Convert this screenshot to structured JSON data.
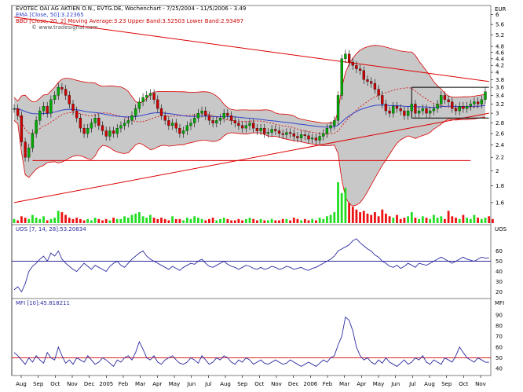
{
  "title": "EVOTEC OAI AG AKTIEN O.N., EVTG.DE, Wochenchart - 7/25/2004 - 11/5/2006 - 3.49",
  "watermark": "© www.tradesignal.com",
  "price_axis_label": "EUR",
  "indicators": {
    "ema": "EMA [Close, 50]:3.22365",
    "bbd": "BBD [Close, 20, 2] Moving Average:3.23 Upper Band:3.52503 Lower Band:2.93497",
    "uos": "UOS [7, 14, 28]:53.20834",
    "uos_axis_label": "UOS",
    "mfi": "MFI [10]:45.818211",
    "mfi_axis_label": "MFI"
  },
  "x_axis_labels": [
    "Aug",
    "Sep",
    "Oct",
    "Nov",
    "Dec",
    "2005",
    "Feb",
    "Mar",
    "Apr",
    "May",
    "Jun",
    "Jul",
    "Aug",
    "Sep",
    "Oct",
    "Nov",
    "Dec",
    "2006",
    "Feb",
    "Mar",
    "Apr",
    "May",
    "Jun",
    "Jul",
    "Aug",
    "Sep",
    "Oct",
    "Nov"
  ],
  "colors": {
    "candle_up": "#00aa00",
    "candle_down": "#cc0000",
    "ema_line": "#3344cc",
    "band_fill": "#c8c8c8",
    "trend_line": "#dd0000",
    "volume_up": "#22dd22",
    "volume_down": "#ee1111",
    "oscillator_line": "#2a2aa0"
  },
  "chart_data": [
    {
      "type": "candlestick",
      "title": "EVOTEC OAI AG AKTIEN O.N., EVTG.DE, Wochenchart - 7/25/2004 - 11/5/2006 - 3.49",
      "ylabel": "EUR",
      "y_scale": "log",
      "ylim": [
        1.4,
        6.4
      ],
      "y_ticks": [
        1.6,
        1.8,
        2,
        2.2,
        2.4,
        2.6,
        2.8,
        3,
        3.2,
        3.4,
        3.6,
        3.8,
        4,
        4.2,
        4.4,
        4.6,
        4.8,
        5.2,
        5.6,
        6
      ],
      "close": [
        3.1,
        2.95,
        2.45,
        2.2,
        2.35,
        2.6,
        2.85,
        3.05,
        3.15,
        3.0,
        3.3,
        3.4,
        3.6,
        3.55,
        3.4,
        3.2,
        3.05,
        2.9,
        2.7,
        2.6,
        2.7,
        2.8,
        2.9,
        2.75,
        2.65,
        2.55,
        2.65,
        2.6,
        2.7,
        2.75,
        2.8,
        2.85,
        2.95,
        3.1,
        3.25,
        3.35,
        3.4,
        3.45,
        3.3,
        3.1,
        2.95,
        2.85,
        2.75,
        2.8,
        2.7,
        2.6,
        2.65,
        2.75,
        2.8,
        2.9,
        3.0,
        3.05,
        2.95,
        2.85,
        2.8,
        2.85,
        2.9,
        3.0,
        2.95,
        2.85,
        2.8,
        2.75,
        2.7,
        2.75,
        2.8,
        2.7,
        2.65,
        2.7,
        2.6,
        2.62,
        2.68,
        2.65,
        2.6,
        2.58,
        2.62,
        2.6,
        2.55,
        2.52,
        2.58,
        2.56,
        2.5,
        2.52,
        2.48,
        2.55,
        2.6,
        2.7,
        2.75,
        2.85,
        3.4,
        4.4,
        4.55,
        4.3,
        4.2,
        4.1,
        4.05,
        3.8,
        3.75,
        3.7,
        3.55,
        3.4,
        3.2,
        3.05,
        3.0,
        3.15,
        3.1,
        3.05,
        2.95,
        3.05,
        3.2,
        3.0,
        3.05,
        3.1,
        3.0,
        3.05,
        3.1,
        3.2,
        3.4,
        3.3,
        3.25,
        3.1,
        3.05,
        3.15,
        3.1,
        3.15,
        3.2,
        3.25,
        3.2,
        3.3,
        3.49
      ],
      "series": [
        {
          "name": "EMA [Close, 50]",
          "last": 3.22365
        },
        {
          "name": "BBD Moving Average",
          "last": 3.23
        },
        {
          "name": "BBD Upper Band",
          "last": 3.52503
        },
        {
          "name": "BBD Lower Band",
          "last": 2.93497
        }
      ],
      "lines": [
        {
          "from": 0,
          "to": 129,
          "y_from": 5.9,
          "y_to": 3.75
        },
        {
          "from": 0,
          "to": 129,
          "y_from": 1.6,
          "y_to": 3.0
        },
        {
          "from": 5,
          "to": 124,
          "y_from": 2.15,
          "y_to": 2.15
        },
        {
          "from": 108,
          "to": 129,
          "y_from": 3.6,
          "y_to": 3.6
        },
        {
          "from": 108,
          "to": 129,
          "y_from": 2.9,
          "y_to": 2.9
        }
      ]
    },
    {
      "type": "bar",
      "title": "Volume",
      "values": [
        3,
        2,
        5,
        4,
        3,
        6,
        4,
        3,
        5,
        2,
        3,
        4,
        9,
        8,
        6,
        4,
        3,
        4,
        3,
        2,
        3,
        2,
        4,
        3,
        2,
        3,
        2,
        4,
        3,
        3,
        5,
        4,
        6,
        7,
        8,
        5,
        4,
        6,
        4,
        3,
        4,
        3,
        2,
        5,
        3,
        3,
        2,
        4,
        3,
        5,
        4,
        3,
        2,
        3,
        4,
        2,
        3,
        4,
        3,
        2,
        2,
        3,
        2,
        3,
        4,
        3,
        2,
        3,
        2,
        2,
        3,
        2,
        2,
        3,
        3,
        2,
        4,
        3,
        2,
        3,
        2,
        3,
        2,
        4,
        3,
        5,
        6,
        8,
        30,
        22,
        26,
        15,
        12,
        10,
        8,
        9,
        7,
        6,
        8,
        5,
        10,
        7,
        5,
        4,
        6,
        3,
        4,
        5,
        8,
        4,
        3,
        5,
        4,
        3,
        6,
        4,
        5,
        3,
        9,
        5,
        4,
        3,
        6,
        4,
        3,
        6,
        4,
        3,
        4,
        5,
        3
      ]
    },
    {
      "type": "line",
      "title": "UOS [7, 14, 28]:53.20834",
      "ylabel": "UOS",
      "ylim": [
        15,
        75
      ],
      "y_ticks": [
        20,
        30,
        40,
        50,
        60
      ],
      "reference_line": 50,
      "last": 53.20834,
      "values": [
        22,
        25,
        20,
        28,
        40,
        45,
        48,
        52,
        55,
        50,
        58,
        55,
        60,
        52,
        48,
        45,
        42,
        40,
        44,
        48,
        45,
        42,
        46,
        44,
        42,
        40,
        45,
        48,
        50,
        46,
        44,
        48,
        52,
        55,
        58,
        60,
        55,
        52,
        50,
        48,
        46,
        44,
        42,
        45,
        43,
        41,
        44,
        46,
        48,
        47,
        50,
        52,
        48,
        45,
        44,
        46,
        48,
        50,
        47,
        45,
        44,
        42,
        44,
        46,
        45,
        43,
        42,
        44,
        42,
        43,
        45,
        44,
        42,
        43,
        45,
        44,
        42,
        43,
        44,
        42,
        41,
        43,
        44,
        46,
        48,
        50,
        52,
        55,
        60,
        62,
        64,
        66,
        70,
        72,
        68,
        65,
        62,
        60,
        56,
        54,
        50,
        48,
        45,
        44,
        46,
        43,
        45,
        48,
        46,
        44,
        48,
        47,
        46,
        48,
        50,
        52,
        54,
        52,
        50,
        48,
        50,
        52,
        54,
        52,
        51,
        50,
        52,
        54,
        53,
        53.2
      ]
    },
    {
      "type": "line",
      "title": "MFI [10]:45.818211",
      "ylabel": "MFI",
      "ylim": [
        35,
        95
      ],
      "y_ticks": [
        40,
        50,
        60,
        70,
        80,
        90
      ],
      "reference_line": 50,
      "last": 45.818211,
      "values": [
        55,
        52,
        48,
        44,
        50,
        46,
        52,
        48,
        45,
        55,
        50,
        48,
        60,
        52,
        45,
        48,
        44,
        50,
        48,
        46,
        52,
        48,
        44,
        46,
        50,
        48,
        45,
        42,
        48,
        46,
        50,
        52,
        48,
        55,
        65,
        58,
        50,
        48,
        52,
        46,
        44,
        48,
        50,
        52,
        48,
        45,
        44,
        46,
        50,
        48,
        45,
        52,
        48,
        44,
        46,
        50,
        48,
        52,
        50,
        46,
        44,
        48,
        46,
        50,
        48,
        44,
        46,
        48,
        45,
        44,
        46,
        48,
        46,
        44,
        45,
        48,
        46,
        44,
        42,
        44,
        46,
        44,
        42,
        45,
        48,
        46,
        50,
        52,
        62,
        70,
        88,
        85,
        75,
        60,
        52,
        48,
        50,
        46,
        44,
        48,
        45,
        50,
        46,
        44,
        42,
        45,
        48,
        44,
        46,
        50,
        48,
        52,
        46,
        44,
        48,
        46,
        44,
        50,
        48,
        46,
        52,
        60,
        55,
        50,
        48,
        46,
        50,
        48,
        46,
        45.8
      ]
    }
  ]
}
